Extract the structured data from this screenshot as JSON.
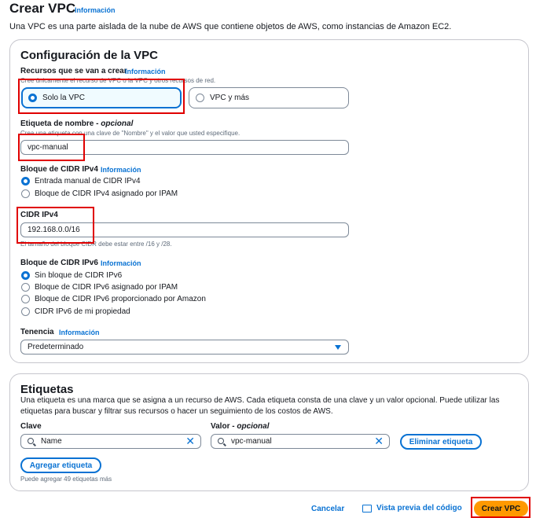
{
  "header": {
    "title": "Crear VPC",
    "info": "Información",
    "description": "Una VPC es una parte aislada de la nube de AWS que contiene objetos de AWS, como instancias de Amazon EC2."
  },
  "config": {
    "heading": "Configuración de la VPC",
    "resources": {
      "label": "Recursos que se van a crear",
      "info": "Información",
      "hint": "Cree únicamente el recurso de VPC o la VPC y otros recursos de red.",
      "options": [
        "Solo la VPC",
        "VPC y más"
      ],
      "selected": "Solo la VPC"
    },
    "name_tag": {
      "label": "Etiqueta de nombre",
      "optional": "opcional",
      "hint": "Crea una etiqueta con una clave de \"Nombre\" y el valor que usted especifique.",
      "value": "vpc-manual"
    },
    "ipv4_block": {
      "label": "Bloque de CIDR IPv4",
      "info": "Información",
      "options": [
        "Entrada manual de CIDR IPv4",
        "Bloque de CIDR IPv4 asignado por IPAM"
      ],
      "selected": "Entrada manual de CIDR IPv4"
    },
    "ipv4_cidr": {
      "label": "CIDR IPv4",
      "value": "192.168.0.0/16",
      "hint": "El tamaño del bloque CIDR debe estar entre /16 y /28."
    },
    "ipv6_block": {
      "label": "Bloque de CIDR IPv6",
      "info": "Información",
      "options": [
        "Sin bloque de CIDR IPv6",
        "Bloque de CIDR IPv6 asignado por IPAM",
        "Bloque de CIDR IPv6 proporcionado por Amazon",
        "CIDR IPv6 de mi propiedad"
      ],
      "selected": "Sin bloque de CIDR IPv6"
    },
    "tenancy": {
      "label": "Tenencia",
      "info": "Información",
      "value": "Predeterminado"
    }
  },
  "tags": {
    "heading": "Etiquetas",
    "description": "Una etiqueta es una marca que se asigna a un recurso de AWS. Cada etiqueta consta de una clave y un valor opcional. Puede utilizar las etiquetas para buscar y filtrar sus recursos o hacer un seguimiento de los costos de AWS.",
    "key_label": "Clave",
    "value_label": "Valor",
    "value_optional": "opcional",
    "key_value": "Name",
    "value_value": "vpc-manual",
    "remove_button": "Eliminar etiqueta",
    "add_button": "Agregar etiqueta",
    "limit_hint": "Puede agregar 49 etiquetas más"
  },
  "footer": {
    "cancel": "Cancelar",
    "preview": "Vista previa del código",
    "create": "Crear VPC"
  },
  "colors": {
    "accent": "#0972d3",
    "primary_button": "#ff9900",
    "highlight": "#e00000"
  }
}
